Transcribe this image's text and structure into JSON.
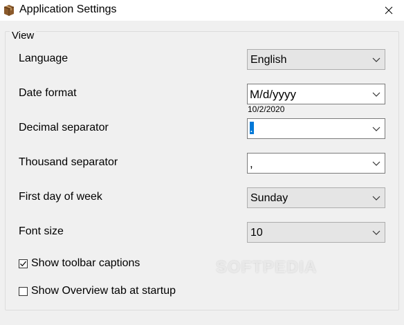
{
  "window": {
    "title": "Application Settings",
    "icon": "box-icon",
    "close_glyph": "✕"
  },
  "group": {
    "legend": "View"
  },
  "fields": {
    "language": {
      "label": "Language",
      "value": "English"
    },
    "date_format": {
      "label": "Date format",
      "value": "M/d/yyyy",
      "sample": "10/2/2020"
    },
    "decimal_separator": {
      "label": "Decimal separator",
      "value": "."
    },
    "thousand_separator": {
      "label": "Thousand separator",
      "value": ","
    },
    "first_day": {
      "label": "First day of week",
      "value": "Sunday"
    },
    "font_size": {
      "label": "Font size",
      "value": "10"
    }
  },
  "options": {
    "toolbar_captions": {
      "label": "Show toolbar captions",
      "checked": true
    },
    "overview_tab": {
      "label": "Show Overview tab at startup",
      "checked": false
    }
  },
  "watermark": "SOFTPEDIA",
  "colors": {
    "selection": "#0078d7",
    "dropdown_bg": "#e5e5e5",
    "window_bg": "#f0f0f0"
  }
}
